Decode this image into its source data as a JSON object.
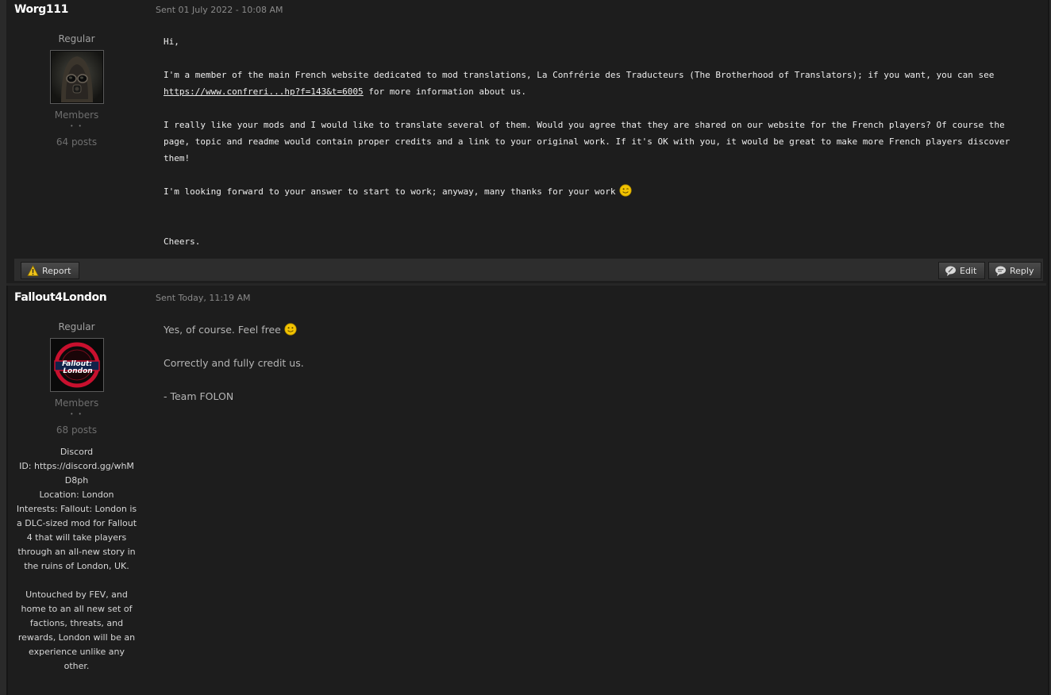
{
  "posts": [
    {
      "author": "Worg111",
      "date": "Sent 01 July 2022 - 10:08 AM",
      "rank": "Regular",
      "group": "Members",
      "pips": "• •",
      "posts": "64 posts",
      "body": {
        "greeting": "Hi,",
        "p1_before": "I'm a member of the main French website dedicated to mod translations, La Confrérie des Traducteurs (The Brotherhood of Translators); if you want, you can see ",
        "p1_link": "https://www.confreri...hp?f=143&t=6005",
        "p1_after": " for more information about us.",
        "p2": "I really like your mods and I would like to translate several of them. Would you agree that they are shared on our website for the French players? Of course the page, topic and readme would contain proper credits and a link to your original work. If it's OK with you, it would be great to make more French players discover them!",
        "p3": "I'm looking forward to your answer to start to work; anyway, many thanks for your work",
        "closing": "Cheers."
      },
      "controls": {
        "report": "Report",
        "edit": "Edit",
        "reply": "Reply"
      }
    },
    {
      "author": "Fallout4London",
      "date": "Sent Today, 11:19 AM",
      "rank": "Regular",
      "avatar_text_1": "Fallout:",
      "avatar_text_2": "London",
      "group": "Members",
      "pips": "• •",
      "posts": "68 posts",
      "custom_fields": {
        "discord_label": "Discord",
        "discord_value": "ID: https://discord.gg/whMD8ph",
        "location": "Location: London",
        "interests": "Interests: Fallout: London is a DLC-sized mod for Fallout 4 that will take players through an all-new story in the ruins of London, UK.",
        "interests_2": "Untouched by FEV, and home to an all new set of factions, threats, and rewards, London will be an experience unlike any other."
      },
      "body": {
        "p1": "Yes, of course. Feel free",
        "p2": "Correctly and fully credit us.",
        "p3": "- Team FOLON"
      }
    }
  ],
  "colors": {
    "background": "#1d1d1d",
    "frame": "#2a2a2a",
    "controls_bar": "#2d2d2d",
    "text_primary": "#ededed",
    "text_muted": "#8a8a8a",
    "smiley": "#f2c300"
  }
}
